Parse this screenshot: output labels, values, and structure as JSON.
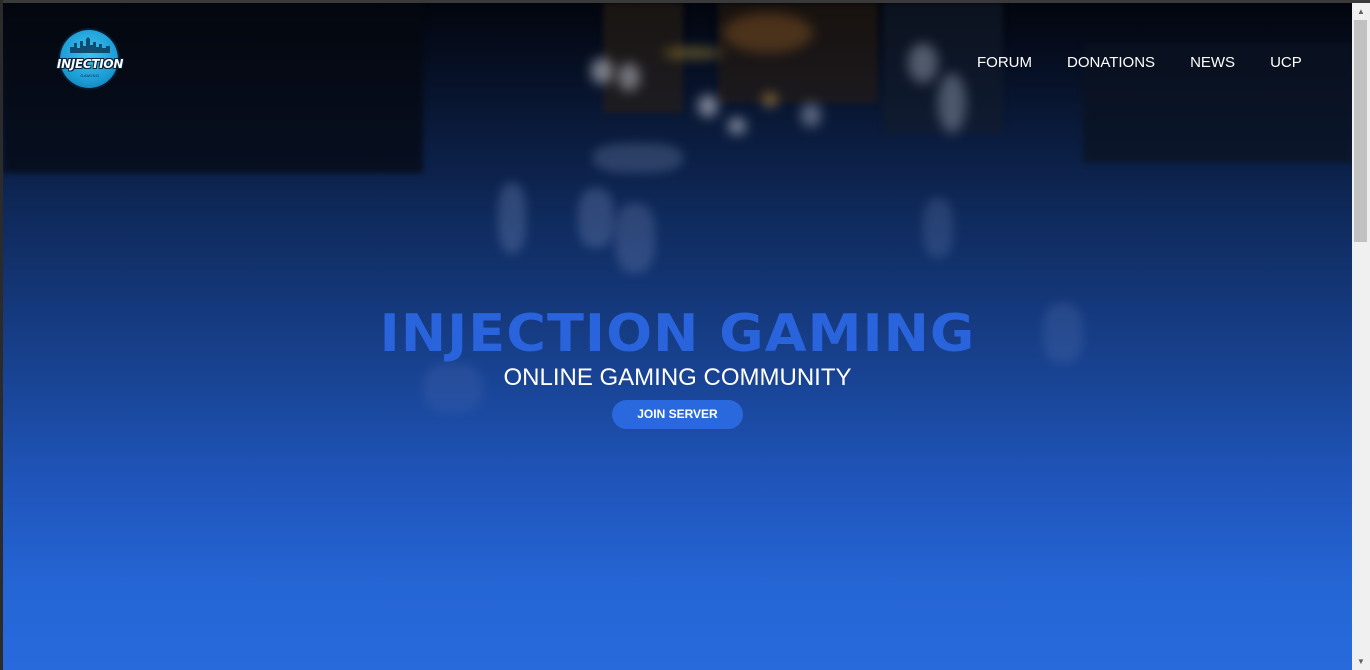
{
  "header": {
    "logo": {
      "text": "INJECTION",
      "subtext": "GAMING",
      "icon": "skyline-logo-icon"
    },
    "nav": [
      {
        "label": "FORUM"
      },
      {
        "label": "DONATIONS"
      },
      {
        "label": "NEWS"
      },
      {
        "label": "UCP"
      }
    ]
  },
  "hero": {
    "title": "INJECTION GAMING",
    "subtitle": "ONLINE GAMING COMMUNITY",
    "button_label": "JOIN SERVER"
  },
  "scrollbar": {
    "up_icon": "arrow-up-icon",
    "down_icon": "arrow-down-icon"
  },
  "colors": {
    "accent": "#2a64dc",
    "button": "#2a68de",
    "nav_text": "#ffffff"
  }
}
